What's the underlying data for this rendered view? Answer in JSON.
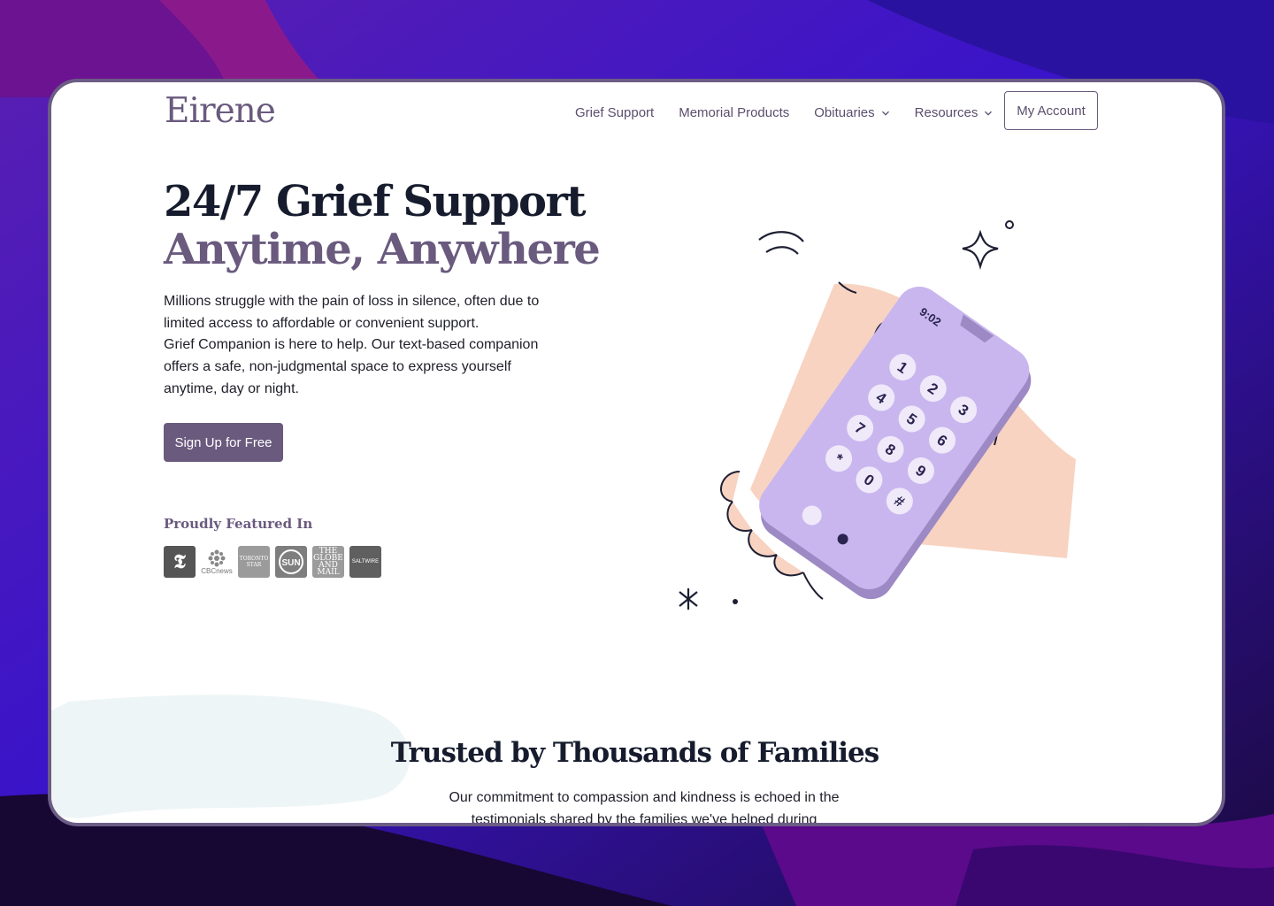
{
  "brand": {
    "logo": "Eirene"
  },
  "nav": {
    "items": [
      {
        "label": "Grief Support",
        "dropdown": false
      },
      {
        "label": "Memorial Products",
        "dropdown": false
      },
      {
        "label": "Obituaries",
        "dropdown": true
      },
      {
        "label": "Resources",
        "dropdown": true
      }
    ],
    "account": "My Account"
  },
  "hero": {
    "title_line1": "24/7 Grief Support",
    "title_line2": "Anytime, Anywhere",
    "paragraph1": "Millions struggle with the pain of loss in silence, often due to limited access to affordable or convenient support.",
    "paragraph2": "Grief Companion is here to help. Our text-based companion offers a safe, non-judgmental space to express yourself anytime, day or night.",
    "cta": "Sign Up for Free"
  },
  "featured": {
    "heading": "Proudly Featured In",
    "logos": [
      {
        "name": "new-york-times",
        "text": "𝕿"
      },
      {
        "name": "cbc-news",
        "text": "CBCnews"
      },
      {
        "name": "toronto-star",
        "text": "TORONTO STAR"
      },
      {
        "name": "toronto-sun",
        "text": "SUN"
      },
      {
        "name": "globe-and-mail",
        "text": "THE GLOBE AND MAIL"
      },
      {
        "name": "saltwire",
        "text": "SALTWIRE"
      }
    ]
  },
  "phone": {
    "time": "9:02",
    "keys": [
      "1",
      "2",
      "3",
      "4",
      "5",
      "6",
      "7",
      "8",
      "9",
      "*",
      "0",
      "#"
    ]
  },
  "trusted": {
    "heading": "Trusted by Thousands of Families",
    "text": "Our commitment to compassion and kindness is echoed in the testimonials shared by the families we've helped during"
  },
  "colors": {
    "brand": "#6a5a7e",
    "heading": "#161c2d",
    "phone": "#c9b6ee",
    "hand": "#f8d3c1"
  }
}
